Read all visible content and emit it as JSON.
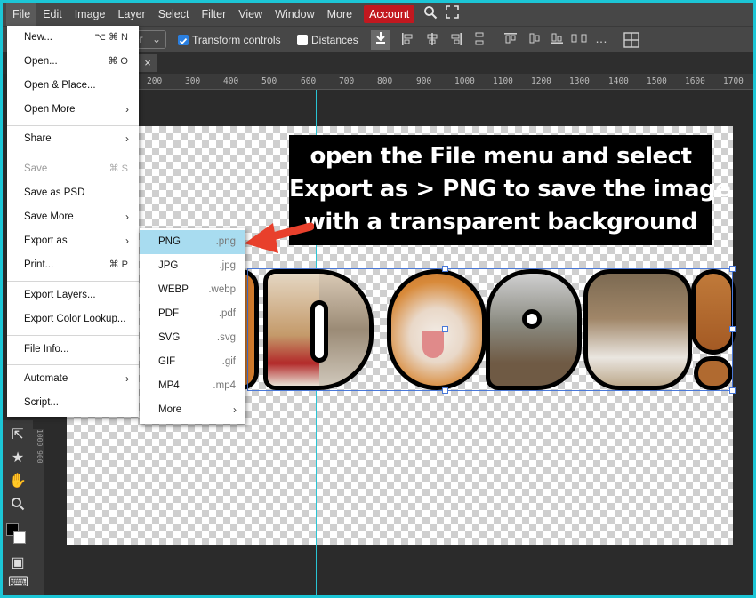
{
  "menubar": {
    "items": [
      "File",
      "Edit",
      "Image",
      "Layer",
      "Select",
      "Filter",
      "View",
      "Window",
      "More"
    ],
    "account": "Account",
    "search_icon": "search-icon",
    "fullscreen_icon": "fullscreen-icon"
  },
  "options": {
    "select_value": "er",
    "transform_label": "Transform controls",
    "distances_label": "Distances",
    "transform_checked": true,
    "distances_checked": false
  },
  "tab": {
    "close": "×"
  },
  "ruler": {
    "ticks": [
      "200",
      "300",
      "400",
      "500",
      "600",
      "700",
      "800",
      "900",
      "1000",
      "1100",
      "1200",
      "1300",
      "1400",
      "1500",
      "1600",
      "1700"
    ]
  },
  "vruler": "1000 900",
  "callout": {
    "line1": "open the File menu and select",
    "line2": "Export as > PNG to save the image",
    "line3": "with a transparent background",
    "color": "#000000"
  },
  "file_menu": {
    "new": {
      "label": "New...",
      "shortcut": "⌥ ⌘ N"
    },
    "open": {
      "label": "Open...",
      "shortcut": "⌘ O"
    },
    "open_place": {
      "label": "Open & Place..."
    },
    "open_more": {
      "label": "Open More",
      "chevron": "›"
    },
    "share": {
      "label": "Share",
      "chevron": "›"
    },
    "save": {
      "label": "Save",
      "shortcut": "⌘ S"
    },
    "save_psd": {
      "label": "Save as PSD"
    },
    "save_more": {
      "label": "Save More",
      "chevron": "›"
    },
    "export_as": {
      "label": "Export as",
      "chevron": "›"
    },
    "print": {
      "label": "Print...",
      "shortcut": "⌘ P"
    },
    "export_layers": {
      "label": "Export Layers..."
    },
    "export_color": {
      "label": "Export Color Lookup..."
    },
    "file_info": {
      "label": "File Info..."
    },
    "automate": {
      "label": "Automate",
      "chevron": "›"
    },
    "script": {
      "label": "Script..."
    }
  },
  "export_menu": {
    "items": [
      {
        "label": "PNG",
        "ext": ".png"
      },
      {
        "label": "JPG",
        "ext": ".jpg"
      },
      {
        "label": "WEBP",
        "ext": ".webp"
      },
      {
        "label": "PDF",
        "ext": ".pdf"
      },
      {
        "label": "SVG",
        "ext": ".svg"
      },
      {
        "label": "GIF",
        "ext": ".gif"
      },
      {
        "label": "MP4",
        "ext": ".mp4"
      }
    ],
    "more": {
      "label": "More",
      "chevron": "›"
    },
    "highlight": "#a8dcf0"
  },
  "colors": {
    "accent": "#1cc6d6",
    "account": "#c2181f",
    "arrow": "#e8402c",
    "selection": "#4a78d8"
  }
}
